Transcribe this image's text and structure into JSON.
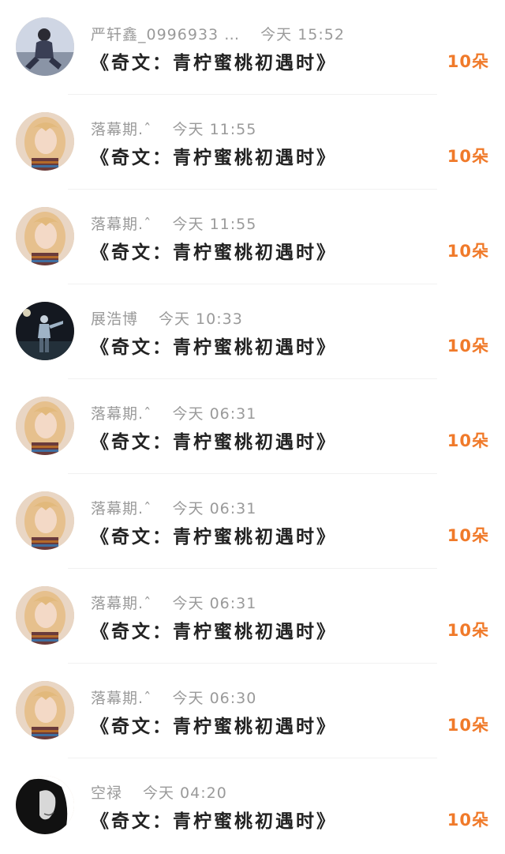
{
  "gift_list": {
    "items": [
      {
        "username": "严轩鑫_0996933 …",
        "time": "今天 15:52",
        "title": "《奇文：青柠蜜桃初遇时》",
        "amount": "10朵",
        "avatar": "person-sitting"
      },
      {
        "username": "落幕期.ˆ",
        "time": "今天 11:55",
        "title": "《奇文：青柠蜜桃初遇时》",
        "amount": "10朵",
        "avatar": "blonde-girl"
      },
      {
        "username": "落幕期.ˆ",
        "time": "今天 11:55",
        "title": "《奇文：青柠蜜桃初遇时》",
        "amount": "10朵",
        "avatar": "blonde-girl"
      },
      {
        "username": "展浩博",
        "time": "今天 10:33",
        "title": "《奇文：青柠蜜桃初遇时》",
        "amount": "10朵",
        "avatar": "night-figure"
      },
      {
        "username": "落幕期.ˆ",
        "time": "今天 06:31",
        "title": "《奇文：青柠蜜桃初遇时》",
        "amount": "10朵",
        "avatar": "blonde-girl"
      },
      {
        "username": "落幕期.ˆ",
        "time": "今天 06:31",
        "title": "《奇文：青柠蜜桃初遇时》",
        "amount": "10朵",
        "avatar": "blonde-girl"
      },
      {
        "username": "落幕期.ˆ",
        "time": "今天 06:31",
        "title": "《奇文：青柠蜜桃初遇时》",
        "amount": "10朵",
        "avatar": "blonde-girl"
      },
      {
        "username": "落幕期.ˆ",
        "time": "今天 06:30",
        "title": "《奇文：青柠蜜桃初遇时》",
        "amount": "10朵",
        "avatar": "blonde-girl"
      },
      {
        "username": "空禄",
        "time": "今天 04:20",
        "title": "《奇文：青柠蜜桃初遇时》",
        "amount": "10朵",
        "avatar": "bw-portrait"
      }
    ]
  },
  "colors": {
    "amount": "#f07a2a",
    "meta": "#9a9a9a",
    "title": "#222222"
  }
}
